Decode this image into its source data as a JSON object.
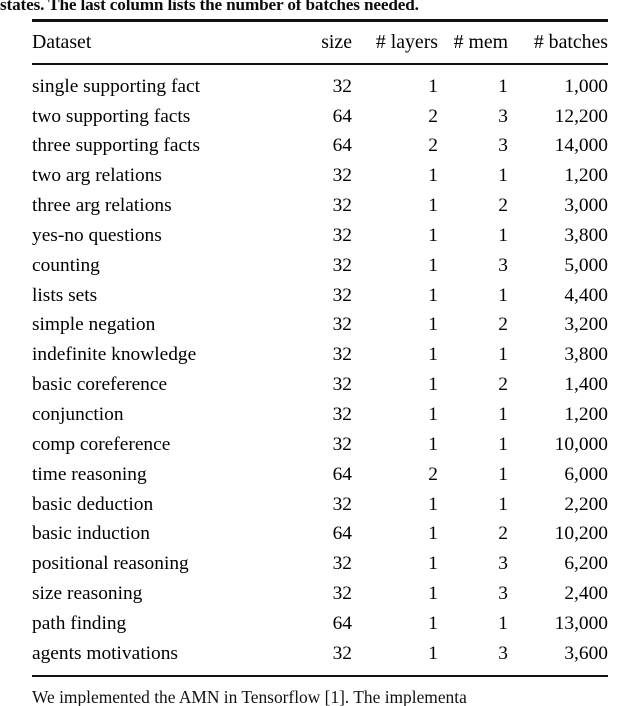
{
  "caption": {
    "text": "states. The last column lists the number of batches needed."
  },
  "table": {
    "columns": [
      {
        "key": "dataset",
        "label": "Dataset",
        "align": "left"
      },
      {
        "key": "size",
        "label": "size",
        "align": "right"
      },
      {
        "key": "layers",
        "label": "# layers",
        "align": "right"
      },
      {
        "key": "mem",
        "label": "# mem",
        "align": "right"
      },
      {
        "key": "batches",
        "label": "# batches",
        "align": "right"
      }
    ],
    "rows": [
      {
        "dataset": "single supporting fact",
        "size": "32",
        "layers": "1",
        "mem": "1",
        "batches": "1,000"
      },
      {
        "dataset": "two supporting facts",
        "size": "64",
        "layers": "2",
        "mem": "3",
        "batches": "12,200"
      },
      {
        "dataset": "three supporting facts",
        "size": "64",
        "layers": "2",
        "mem": "3",
        "batches": "14,000"
      },
      {
        "dataset": "two arg relations",
        "size": "32",
        "layers": "1",
        "mem": "1",
        "batches": "1,200"
      },
      {
        "dataset": "three arg relations",
        "size": "32",
        "layers": "1",
        "mem": "2",
        "batches": "3,000"
      },
      {
        "dataset": "yes-no questions",
        "size": "32",
        "layers": "1",
        "mem": "1",
        "batches": "3,800"
      },
      {
        "dataset": "counting",
        "size": "32",
        "layers": "1",
        "mem": "3",
        "batches": "5,000"
      },
      {
        "dataset": "lists sets",
        "size": "32",
        "layers": "1",
        "mem": "1",
        "batches": "4,400"
      },
      {
        "dataset": "simple negation",
        "size": "32",
        "layers": "1",
        "mem": "2",
        "batches": "3,200"
      },
      {
        "dataset": "indefinite knowledge",
        "size": "32",
        "layers": "1",
        "mem": "1",
        "batches": "3,800"
      },
      {
        "dataset": "basic coreference",
        "size": "32",
        "layers": "1",
        "mem": "2",
        "batches": "1,400"
      },
      {
        "dataset": "conjunction",
        "size": "32",
        "layers": "1",
        "mem": "1",
        "batches": "1,200"
      },
      {
        "dataset": "comp coreference",
        "size": "32",
        "layers": "1",
        "mem": "1",
        "batches": "10,000"
      },
      {
        "dataset": "time reasoning",
        "size": "64",
        "layers": "2",
        "mem": "1",
        "batches": "6,000"
      },
      {
        "dataset": "basic deduction",
        "size": "32",
        "layers": "1",
        "mem": "1",
        "batches": "2,200"
      },
      {
        "dataset": "basic induction",
        "size": "64",
        "layers": "1",
        "mem": "2",
        "batches": "10,200"
      },
      {
        "dataset": "positional reasoning",
        "size": "32",
        "layers": "1",
        "mem": "3",
        "batches": "6,200"
      },
      {
        "dataset": "size reasoning",
        "size": "32",
        "layers": "1",
        "mem": "3",
        "batches": "2,400"
      },
      {
        "dataset": "path finding",
        "size": "64",
        "layers": "1",
        "mem": "1",
        "batches": "13,000"
      },
      {
        "dataset": "agents motivations",
        "size": "32",
        "layers": "1",
        "mem": "3",
        "batches": "3,600"
      }
    ]
  },
  "body_text": {
    "paragraph": "We implemented the AMN in Tensorflow [1]. The implementa"
  },
  "colors": {
    "text": "#000000",
    "rule": "#111111",
    "background": "#ffffff"
  }
}
